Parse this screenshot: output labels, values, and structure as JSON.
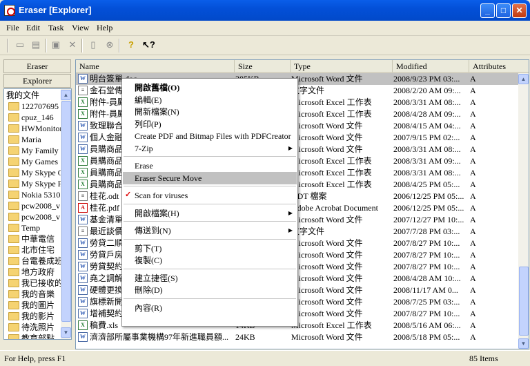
{
  "window": {
    "title": "Eraser  [Explorer]"
  },
  "menu": [
    "File",
    "Edit",
    "Task",
    "View",
    "Help"
  ],
  "left_tabs": {
    "eraser": "Eraser",
    "explorer": "Explorer"
  },
  "tree": [
    "我的文件",
    "122707695",
    "cpuz_146",
    "HWMonitor",
    "Maria",
    "My Family",
    "My Games",
    "My Skype C",
    "My Skype F",
    "Nokia 5310",
    "pcw2008_v",
    "pcw2008_v",
    "Temp",
    "中華電信",
    "北市住宅",
    "台電養成班",
    "地方政府",
    "我已接收的",
    "我的音樂",
    "我的圖片",
    "我的影片",
    "待洗照片",
    "教育部點"
  ],
  "columns": {
    "name": "Name",
    "size": "Size",
    "type": "Type",
    "modified": "Modified",
    "attributes": "Attributes"
  },
  "files": [
    {
      "name": "明台簽單.doc",
      "size": "385KB",
      "type": "Microsoft Word 文件",
      "modified": "2008/9/23 PM 03:...",
      "attr": "A",
      "icon": "word"
    },
    {
      "name": "金石堂傳",
      "size": "",
      "type": "文字文件",
      "modified": "2008/2/20 AM 09:...",
      "attr": "A",
      "icon": "txt"
    },
    {
      "name": "附件-員勵",
      "size": "",
      "type": "Microsoft Excel 工作表",
      "modified": "2008/3/31 AM 08:...",
      "attr": "A",
      "icon": "excel"
    },
    {
      "name": "附件-員勵",
      "size": "",
      "type": "Microsoft Excel 工作表",
      "modified": "2008/4/28 AM 09:...",
      "attr": "A",
      "icon": "excel"
    },
    {
      "name": "致理聯合",
      "size": "",
      "type": "Microsoft Word 文件",
      "modified": "2008/4/15 AM 04:...",
      "attr": "A",
      "icon": "word"
    },
    {
      "name": "個人金融",
      "size": "",
      "type": "Microsoft Word 文件",
      "modified": "2007/9/15 PM 02:...",
      "attr": "A",
      "icon": "word"
    },
    {
      "name": "員購商品",
      "size": "",
      "type": "Microsoft Word 文件",
      "modified": "2008/3/31 AM 08:...",
      "attr": "A",
      "icon": "word"
    },
    {
      "name": "員購商品",
      "size": "",
      "type": "Microsoft Excel 工作表",
      "modified": "2008/3/31 AM 09:...",
      "attr": "A",
      "icon": "excel"
    },
    {
      "name": "員購商品",
      "size": "",
      "type": "Microsoft Excel 工作表",
      "modified": "2008/3/31 AM 08:...",
      "attr": "A",
      "icon": "excel"
    },
    {
      "name": "員購商品",
      "size": "",
      "type": "Microsoft Excel 工作表",
      "modified": "2008/4/25 PM 05:...",
      "attr": "A",
      "icon": "excel"
    },
    {
      "name": "桂花.odt",
      "size": "",
      "type": "ODT 檔案",
      "modified": "2006/12/25 PM 05:...",
      "attr": "A",
      "icon": "txt"
    },
    {
      "name": "桂花.pdf",
      "size": "",
      "type": "Adobe Acrobat Document",
      "modified": "2006/12/25 PM 05:...",
      "attr": "A",
      "icon": "pdf"
    },
    {
      "name": "基金清單",
      "size": "",
      "type": "Microsoft Word 文件",
      "modified": "2007/12/27 PM 10:...",
      "attr": "A",
      "icon": "word"
    },
    {
      "name": "最近談價",
      "size": "",
      "type": "文字文件",
      "modified": "2007/7/28 PM 03:...",
      "attr": "A",
      "icon": "txt"
    },
    {
      "name": "勞貸二順",
      "size": "",
      "type": "Microsoft Word 文件",
      "modified": "2007/8/27 PM 10:...",
      "attr": "A",
      "icon": "word"
    },
    {
      "name": "勞貸戶房",
      "size": "",
      "type": "Microsoft Word 文件",
      "modified": "2007/8/27 PM 10:...",
      "attr": "A",
      "icon": "word"
    },
    {
      "name": "勞貸契約",
      "size": "",
      "type": "Microsoft Word 文件",
      "modified": "2007/8/27 PM 10:...",
      "attr": "A",
      "icon": "word"
    },
    {
      "name": "堯之調解",
      "size": "",
      "type": "Microsoft Word 文件",
      "modified": "2008/4/28 AM 10:...",
      "attr": "A",
      "icon": "word"
    },
    {
      "name": "硬體更換",
      "size": "",
      "type": "Microsoft Word 文件",
      "modified": "2008/11/17 AM 0...",
      "attr": "A",
      "icon": "word"
    },
    {
      "name": "旗標新開",
      "size": "",
      "type": "Microsoft Word 文件",
      "modified": "2008/7/25 PM 03:...",
      "attr": "A",
      "icon": "word"
    },
    {
      "name": "增補契約",
      "size": "",
      "type": "Microsoft Word 文件",
      "modified": "2007/8/27 PM 10:...",
      "attr": "A",
      "icon": "word"
    },
    {
      "name": "稿費.xls",
      "size": "14KB",
      "type": "Microsoft Excel 工作表",
      "modified": "2008/5/16 AM 06:...",
      "attr": "A",
      "icon": "excel"
    },
    {
      "name": "濟濟部所屬事業機構97年新進職員額...",
      "size": "24KB",
      "type": "Microsoft Word 文件",
      "modified": "2008/5/18 PM 05:...",
      "attr": "A",
      "icon": "word"
    }
  ],
  "context_menu": [
    {
      "label": "開啟舊檔(O)",
      "bold": true
    },
    {
      "label": "編輯(E)"
    },
    {
      "label": "開新檔案(N)"
    },
    {
      "label": "列印(P)"
    },
    {
      "label": "Create PDF and Bitmap Files with PDFCreator"
    },
    {
      "label": "7-Zip",
      "submenu": true
    },
    {
      "sep": true
    },
    {
      "label": "Erase"
    },
    {
      "label": "Eraser Secure Move",
      "highlight": true
    },
    {
      "sep": true
    },
    {
      "label": "Scan for viruses",
      "icon": "antivirus-icon"
    },
    {
      "sep": true
    },
    {
      "label": "開啟檔案(H)",
      "submenu": true
    },
    {
      "sep": true
    },
    {
      "label": "傳送到(N)",
      "submenu": true
    },
    {
      "sep": true
    },
    {
      "label": "剪下(T)"
    },
    {
      "label": "複製(C)"
    },
    {
      "sep": true
    },
    {
      "label": "建立捷徑(S)"
    },
    {
      "label": "刪除(D)"
    },
    {
      "sep": true
    },
    {
      "label": "內容(R)"
    }
  ],
  "status": {
    "help": "For Help, press F1",
    "items": "85 Items"
  },
  "colors": {
    "selection": "#c1c1c1",
    "titlebar": "#0a5ee9"
  }
}
